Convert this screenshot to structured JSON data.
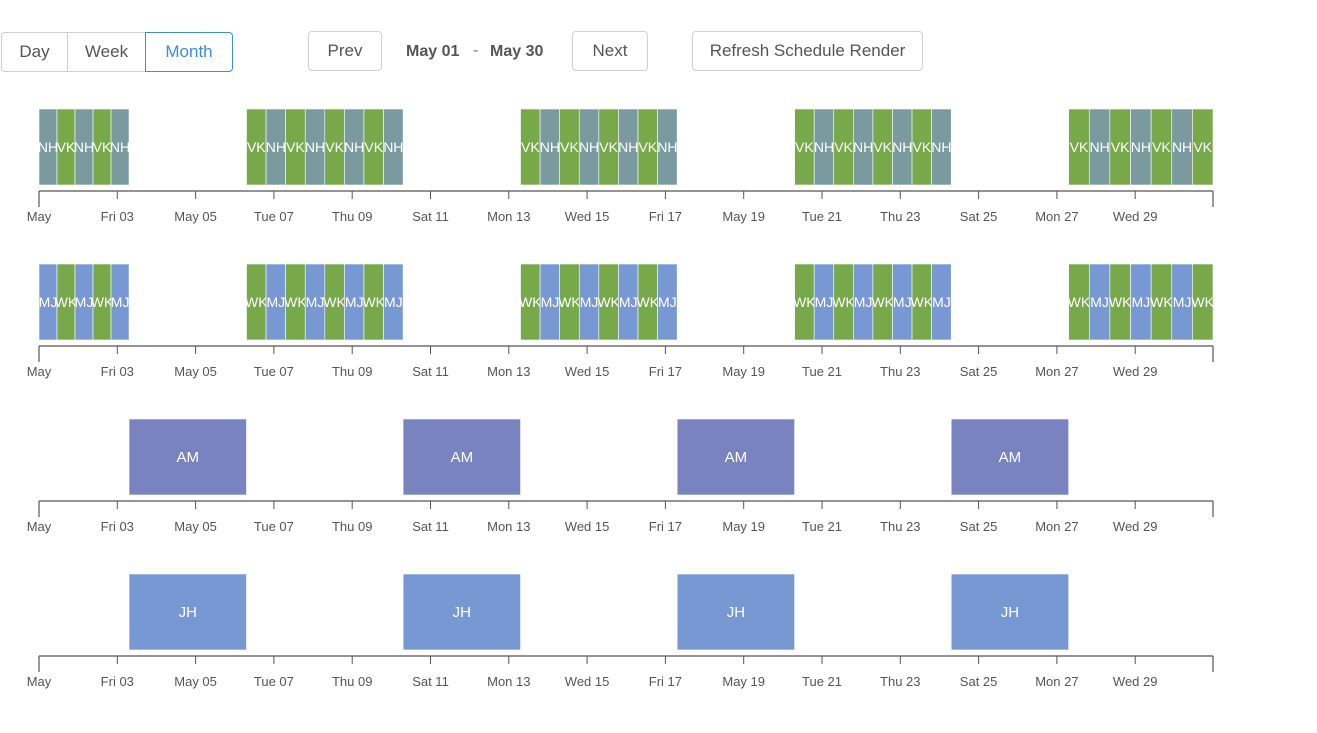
{
  "view_switch": {
    "day_label": "Day",
    "week_label": "Week",
    "month_label": "Month",
    "active": "Month"
  },
  "nav": {
    "prev_label": "Prev",
    "next_label": "Next",
    "range_start": "May 01",
    "range_separator": "-",
    "range_end": "May 30",
    "refresh_label": "Refresh Schedule Render"
  },
  "colors": {
    "green": "#77a94a",
    "slate": "#7a9aa0",
    "blue": "#7898d4",
    "purple": "#7983c0",
    "axis": "#555555",
    "label": "#555555"
  },
  "axis_ticks": [
    "May",
    "Fri 03",
    "May 05",
    "Tue 07",
    "Thu 09",
    "Sat 11",
    "Mon 13",
    "Wed 15",
    "Fri 17",
    "May 19",
    "Tue 21",
    "Thu 23",
    "Sat 25",
    "Mon 27",
    "Wed 29"
  ],
  "rows": [
    {
      "name": "row-vk-nh",
      "blocks": [
        {
          "start_day": 1,
          "end_day": 3.3,
          "stripes": [
            "slate",
            "green",
            "slate",
            "green",
            "slate"
          ],
          "labels": [
            "NH",
            "VK",
            "NH",
            "VK",
            "NH"
          ],
          "first_partial": true
        },
        {
          "start_day": 6.3,
          "end_day": 10.3,
          "stripes": [
            "green",
            "slate",
            "green",
            "slate",
            "green",
            "slate",
            "green",
            "slate"
          ],
          "labels": [
            "VK",
            "NH",
            "VK",
            "NH",
            "VK",
            "NH",
            "VK",
            "NH"
          ]
        },
        {
          "start_day": 13.3,
          "end_day": 17.3,
          "stripes": [
            "green",
            "slate",
            "green",
            "slate",
            "green",
            "slate",
            "green",
            "slate"
          ],
          "labels": [
            "VK",
            "NH",
            "VK",
            "NH",
            "VK",
            "NH",
            "VK",
            "NH"
          ]
        },
        {
          "start_day": 20.3,
          "end_day": 24.3,
          "stripes": [
            "green",
            "slate",
            "green",
            "slate",
            "green",
            "slate",
            "green",
            "slate"
          ],
          "labels": [
            "VK",
            "NH",
            "VK",
            "NH",
            "VK",
            "NH",
            "VK",
            "NH"
          ]
        },
        {
          "start_day": 27.3,
          "end_day": 31.0,
          "stripes": [
            "green",
            "slate",
            "green",
            "slate",
            "green",
            "slate",
            "green"
          ],
          "labels": [
            "VK",
            "NH",
            "VK",
            "NH",
            "VK",
            "NH",
            "VK"
          ],
          "last_partial": true
        }
      ]
    },
    {
      "name": "row-wk-mj",
      "blocks": [
        {
          "start_day": 1,
          "end_day": 3.3,
          "stripes": [
            "blue",
            "green",
            "blue",
            "green",
            "blue"
          ],
          "labels": [
            "MJ",
            "WK",
            "MJ",
            "WK",
            "MJ"
          ],
          "first_partial": true
        },
        {
          "start_day": 6.3,
          "end_day": 10.3,
          "stripes": [
            "green",
            "blue",
            "green",
            "blue",
            "green",
            "blue",
            "green",
            "blue"
          ],
          "labels": [
            "WK",
            "MJ",
            "WK",
            "MJ",
            "WK",
            "MJ",
            "WK",
            "MJ"
          ]
        },
        {
          "start_day": 13.3,
          "end_day": 17.3,
          "stripes": [
            "green",
            "blue",
            "green",
            "blue",
            "green",
            "blue",
            "green",
            "blue"
          ],
          "labels": [
            "WK",
            "MJ",
            "WK",
            "MJ",
            "WK",
            "MJ",
            "WK",
            "MJ"
          ]
        },
        {
          "start_day": 20.3,
          "end_day": 24.3,
          "stripes": [
            "green",
            "blue",
            "green",
            "blue",
            "green",
            "blue",
            "green",
            "blue"
          ],
          "labels": [
            "WK",
            "MJ",
            "WK",
            "MJ",
            "WK",
            "MJ",
            "WK",
            "MJ"
          ]
        },
        {
          "start_day": 27.3,
          "end_day": 31.0,
          "stripes": [
            "green",
            "blue",
            "green",
            "blue",
            "green",
            "blue",
            "green"
          ],
          "labels": [
            "WK",
            "MJ",
            "WK",
            "MJ",
            "WK",
            "MJ",
            "WK"
          ],
          "last_partial": true
        }
      ]
    },
    {
      "name": "row-am",
      "blocks": [
        {
          "start_day": 3.3,
          "end_day": 6.3,
          "stripes": [
            "purple"
          ],
          "labels": [
            "AM"
          ]
        },
        {
          "start_day": 10.3,
          "end_day": 13.3,
          "stripes": [
            "purple"
          ],
          "labels": [
            "AM"
          ]
        },
        {
          "start_day": 17.3,
          "end_day": 20.3,
          "stripes": [
            "purple"
          ],
          "labels": [
            "AM"
          ]
        },
        {
          "start_day": 24.3,
          "end_day": 27.3,
          "stripes": [
            "purple"
          ],
          "labels": [
            "AM"
          ]
        }
      ]
    },
    {
      "name": "row-jh",
      "blocks": [
        {
          "start_day": 3.3,
          "end_day": 6.3,
          "stripes": [
            "blue"
          ],
          "labels": [
            "JH"
          ]
        },
        {
          "start_day": 10.3,
          "end_day": 13.3,
          "stripes": [
            "blue"
          ],
          "labels": [
            "JH"
          ]
        },
        {
          "start_day": 17.3,
          "end_day": 20.3,
          "stripes": [
            "blue"
          ],
          "labels": [
            "JH"
          ]
        },
        {
          "start_day": 24.3,
          "end_day": 27.3,
          "stripes": [
            "blue"
          ],
          "labels": [
            "JH"
          ]
        }
      ]
    }
  ]
}
